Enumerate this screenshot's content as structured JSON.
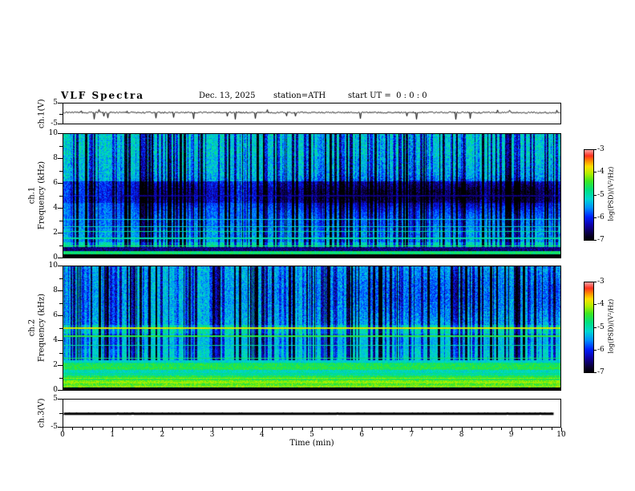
{
  "header": {
    "title": "VLF Spectra",
    "date": "Dec. 13, 2025",
    "station": "station=ATH",
    "start_ut": "start UT =  0 : 0 : 0"
  },
  "axes": {
    "x": {
      "label": "Time (min)",
      "range": [
        0,
        10
      ],
      "ticks": [
        0,
        1,
        2,
        3,
        4,
        5,
        6,
        7,
        8,
        9,
        10
      ],
      "minor_step": 0.2
    },
    "y_spec": {
      "range": [
        0,
        10
      ],
      "ticks": [
        0,
        2,
        4,
        6,
        8,
        10
      ],
      "minor_step": 1
    },
    "y_wave": {
      "range": [
        -5,
        5
      ],
      "ticks": [
        5,
        -5
      ]
    },
    "colorbar": {
      "label": "log(PSD)/(V²/Hz)",
      "range": [
        -7,
        -3
      ],
      "ticks": [
        -3,
        -4,
        -5,
        -6,
        -7
      ]
    }
  },
  "colormap": [
    [
      0,
      "#000000"
    ],
    [
      0.06,
      "#0a0030"
    ],
    [
      0.16,
      "#1000a0"
    ],
    [
      0.26,
      "#0020ff"
    ],
    [
      0.36,
      "#0090ff"
    ],
    [
      0.46,
      "#00d8d0"
    ],
    [
      0.56,
      "#00e080"
    ],
    [
      0.66,
      "#40e820"
    ],
    [
      0.74,
      "#b0f000"
    ],
    [
      0.82,
      "#ffe000"
    ],
    [
      0.88,
      "#ff9000"
    ],
    [
      0.94,
      "#ff3020"
    ],
    [
      1,
      "#ff9a9a"
    ]
  ],
  "chart_data": [
    {
      "type": "line",
      "name": "ch1_time_series",
      "ylabel": "ch.1(V)",
      "xlim": [
        0,
        10
      ],
      "ylim": [
        -5,
        5
      ],
      "xlabel": "Time (min)",
      "color": "#000000",
      "baseline": 0.5,
      "noise_amp": 0.35,
      "spike_prob": 0.03,
      "spike_amp": 3.2,
      "seed": 11,
      "trim_right": 0,
      "thickness": 1,
      "description": "noisy broadband voltage trace near +0.5 V with impulsive spikes down to about -3.5 V"
    },
    {
      "type": "heatmap",
      "name": "ch1_spectrogram",
      "ylabel_line1": "ch.1",
      "ylabel_line2": "Frequency (kHz)",
      "xlim": [
        0,
        10
      ],
      "ylim": [
        0,
        10
      ],
      "zlim": [
        -7,
        -3
      ],
      "zlabel": "log(PSD)/(V²/Hz)",
      "seed": 23,
      "bands": [
        {
          "f": [
            0,
            0.25
          ],
          "level": -7,
          "noise": 0.1
        },
        {
          "f": [
            0.25,
            0.55
          ],
          "level": -4.7,
          "noise": 0.25
        },
        {
          "f": [
            0.55,
            0.85
          ],
          "level": -6.5,
          "noise": 0.3
        },
        {
          "f": [
            0.85,
            1.25
          ],
          "level": -5.0,
          "noise": 0.3
        },
        {
          "f": [
            1.25,
            2.35
          ],
          "level": -5.45,
          "noise": 0.35
        },
        {
          "f": [
            2.35,
            4.4
          ],
          "level": -5.6,
          "noise": 0.3
        },
        {
          "f": [
            4.4,
            6.2
          ],
          "level": -5.85,
          "noise": 0.35
        },
        {
          "f": [
            6.2,
            8.2
          ],
          "level": -5.25,
          "noise": 0.45
        },
        {
          "f": [
            8.2,
            10
          ],
          "level": -5.15,
          "noise": 0.45
        }
      ],
      "lines": [
        {
          "f": 0.95,
          "w": 0.1,
          "level": -4.6
        },
        {
          "f": 1.55,
          "w": 0.1,
          "level": -4.9
        },
        {
          "f": 2.1,
          "w": 0.1,
          "level": -4.85
        },
        {
          "f": 2.5,
          "w": 0.08,
          "level": -5.05
        },
        {
          "f": 3.1,
          "w": 0.07,
          "level": -5.2
        },
        {
          "f": 5.0,
          "w": 0.12,
          "level": -6.5
        }
      ],
      "stripes": {
        "prob": 0.3,
        "strength": 1.6,
        "fmin": 0.85
      },
      "patch": {
        "fc": 5.1,
        "fw": 1.2,
        "strength": 1.1,
        "bias_right": 0.65
      }
    },
    {
      "type": "heatmap",
      "name": "ch2_spectrogram",
      "ylabel_line1": "ch.2",
      "ylabel_line2": "Frequency (kHz)",
      "xlim": [
        0,
        10
      ],
      "ylim": [
        0,
        10
      ],
      "zlim": [
        -7,
        -3
      ],
      "zlabel": "log(PSD)/(V²/Hz)",
      "seed": 47,
      "bands": [
        {
          "f": [
            0,
            0.18
          ],
          "level": -7,
          "noise": 0.1
        },
        {
          "f": [
            0.18,
            0.5
          ],
          "level": -4.35,
          "noise": 0.3
        },
        {
          "f": [
            0.5,
            0.8
          ],
          "level": -4.2,
          "noise": 0.25
        },
        {
          "f": [
            0.8,
            1.15
          ],
          "level": -4.55,
          "noise": 0.3
        },
        {
          "f": [
            1.15,
            1.65
          ],
          "level": -5.05,
          "noise": 0.3
        },
        {
          "f": [
            1.65,
            2.15
          ],
          "level": -4.6,
          "noise": 0.3
        },
        {
          "f": [
            2.15,
            3.3
          ],
          "level": -5.15,
          "noise": 0.3
        },
        {
          "f": [
            3.3,
            4.55
          ],
          "level": -5.3,
          "noise": 0.3
        },
        {
          "f": [
            4.55,
            5.25
          ],
          "level": -4.9,
          "noise": 0.3
        },
        {
          "f": [
            5.25,
            10
          ],
          "level": -5.3,
          "noise": 0.4
        }
      ],
      "lines": [
        {
          "f": 5.0,
          "w": 0.12,
          "level": -3.9
        },
        {
          "f": 4.35,
          "w": 0.09,
          "level": -4.5
        },
        {
          "f": 3.6,
          "w": 0.07,
          "level": -4.9
        },
        {
          "f": 2.55,
          "w": 0.08,
          "level": -4.65
        },
        {
          "f": 2.2,
          "w": 0.08,
          "level": -4.75
        },
        {
          "f": 1.8,
          "w": 0.09,
          "level": -4.5
        },
        {
          "f": 1.3,
          "w": 0.07,
          "level": -4.85
        },
        {
          "f": 0.95,
          "w": 0.09,
          "level": -4.15
        },
        {
          "f": 0.6,
          "w": 0.08,
          "level": -4.1
        },
        {
          "f": 0.32,
          "w": 0.07,
          "level": -4.0
        }
      ],
      "stripes": {
        "prob": 0.27,
        "strength": 1.6,
        "fmin": 2.4
      },
      "patch": {
        "fc": 7.8,
        "fw": 2.2,
        "strength": 0.7,
        "bias_right": 0.4
      }
    },
    {
      "type": "line",
      "name": "ch3_time_series",
      "ylabel": "ch.3(V)",
      "xlim": [
        0,
        10
      ],
      "ylim": [
        -5,
        5
      ],
      "xlabel": "Time (min)",
      "color": "#000000",
      "baseline": -0.2,
      "noise_amp": 0.02,
      "spike_prob": 0,
      "spike_amp": 0,
      "seed": 5,
      "trim_right": 8,
      "thickness": 3,
      "description": "flat (clipped/zero) signal drawn as a thick black line near 0 V"
    }
  ]
}
